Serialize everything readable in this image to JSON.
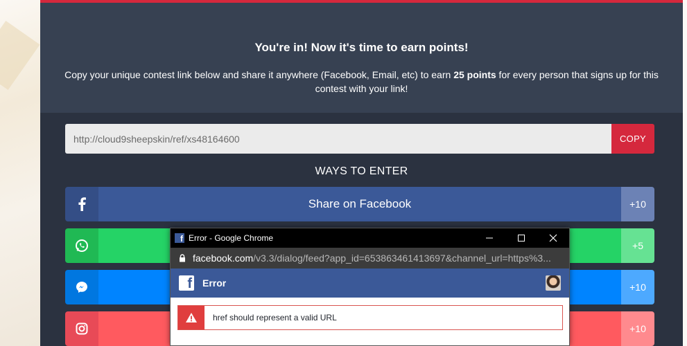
{
  "hero": {
    "title": "You're in! Now it's time to earn points!",
    "desc_before": "Copy your unique contest link below and share it anywhere (Facebook, Email, etc) to earn ",
    "desc_bold": "25 points",
    "desc_after": " for every person that signs up for this contest with your link!"
  },
  "referral": {
    "link": "http://cloud9sheepskin/ref/xs48164600",
    "copy_label": "COPY"
  },
  "ways_title": "WAYS TO ENTER",
  "entries": [
    {
      "icon": "facebook-icon",
      "label": "Share on Facebook",
      "points": "+10"
    },
    {
      "icon": "whatsapp-icon",
      "label": "",
      "points": "+5"
    },
    {
      "icon": "messenger-icon",
      "label": "",
      "points": "+10"
    },
    {
      "icon": "instagram-icon",
      "label": "",
      "points": "+10"
    }
  ],
  "popup": {
    "window_title": "Error - Google Chrome",
    "url_domain": "facebook.com",
    "url_path": "/v3.3/dialog/feed?app_id=653863461413697&channel_url=https%3...",
    "header_title": "Error",
    "error_message": "href should represent a valid URL"
  },
  "colors": {
    "accent_red": "#d5283d",
    "panel_dark": "#2b3240",
    "facebook_blue": "#3b5998",
    "whatsapp_green": "#25d366",
    "messenger_blue": "#0084ff",
    "instagram_red": "#ff5a5f"
  }
}
